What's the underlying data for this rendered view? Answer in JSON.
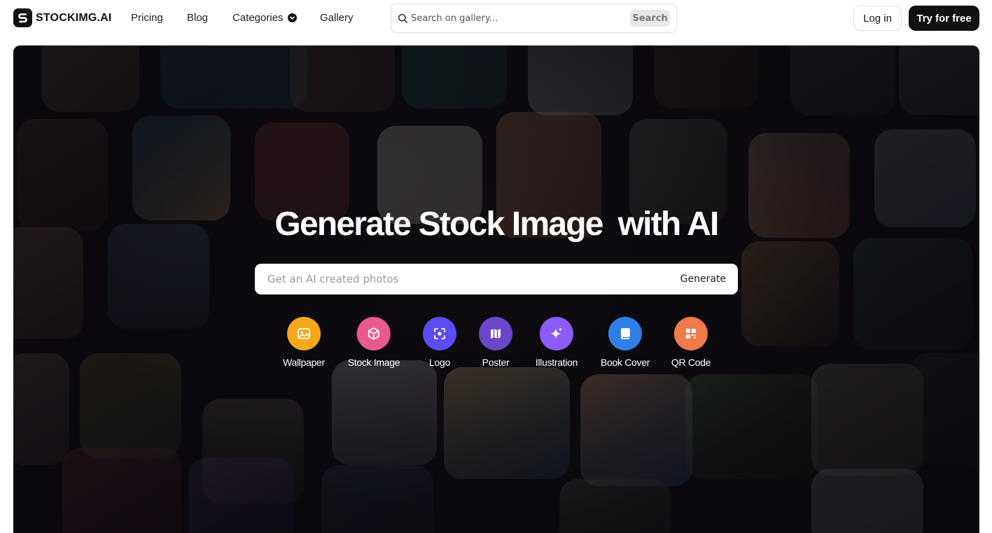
{
  "nav": {
    "logo_text": "STOCKIMG.AI",
    "links": {
      "pricing": "Pricing",
      "blog": "Blog",
      "categories": "Categories",
      "gallery": "Gallery"
    },
    "search": {
      "placeholder": "Search on gallery...",
      "button": "Search"
    },
    "login": "Log in",
    "try_free": "Try for free"
  },
  "hero": {
    "title_part1": "Generate Stock Image",
    "title_part2": "with AI",
    "prompt_placeholder": "Get an AI created photos",
    "generate_button": "Generate",
    "categories": [
      {
        "label": "Wallpaper",
        "icon": "image-icon",
        "color": "#f7a81b"
      },
      {
        "label": "Stock Image",
        "icon": "cube-icon",
        "color": "#ea5a8e"
      },
      {
        "label": "Logo",
        "icon": "focus-icon",
        "color": "#5b4df0"
      },
      {
        "label": "Poster",
        "icon": "map-icon",
        "color": "#6a46c9"
      },
      {
        "label": "Illustration",
        "icon": "sparkle-icon",
        "color": "#8b5cf6"
      },
      {
        "label": "Book Cover",
        "icon": "book-icon",
        "color": "#2f7fe8"
      },
      {
        "label": "QR Code",
        "icon": "qr-code-icon",
        "color": "#f07a4a"
      }
    ]
  },
  "colors": {
    "primary_dark": "#111111",
    "hero_background": "#0e0c10",
    "search_button_bg": "#e8e8e8"
  }
}
